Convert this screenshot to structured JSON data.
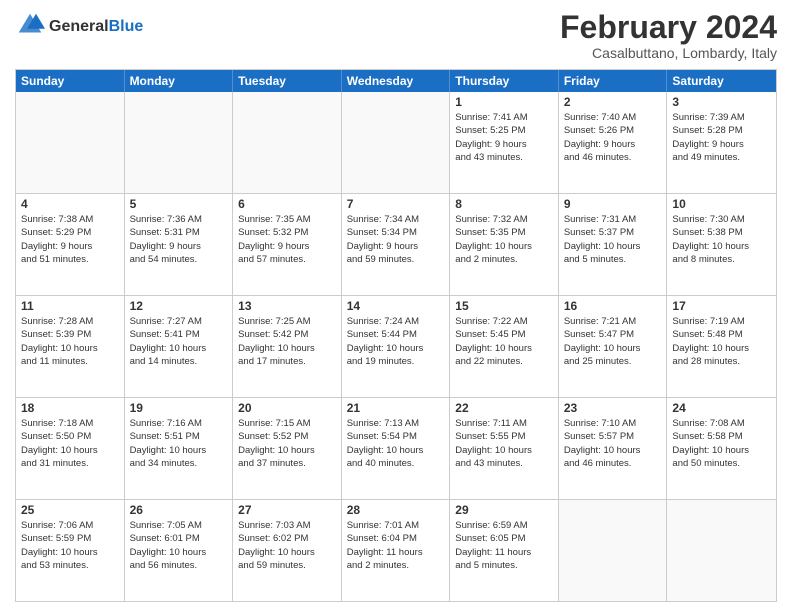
{
  "header": {
    "logo_general": "General",
    "logo_blue": "Blue",
    "main_title": "February 2024",
    "subtitle": "Casalbuttano, Lombardy, Italy"
  },
  "calendar": {
    "days_of_week": [
      "Sunday",
      "Monday",
      "Tuesday",
      "Wednesday",
      "Thursday",
      "Friday",
      "Saturday"
    ],
    "weeks": [
      [
        {
          "day": "",
          "info": ""
        },
        {
          "day": "",
          "info": ""
        },
        {
          "day": "",
          "info": ""
        },
        {
          "day": "",
          "info": ""
        },
        {
          "day": "1",
          "info": "Sunrise: 7:41 AM\nSunset: 5:25 PM\nDaylight: 9 hours\nand 43 minutes."
        },
        {
          "day": "2",
          "info": "Sunrise: 7:40 AM\nSunset: 5:26 PM\nDaylight: 9 hours\nand 46 minutes."
        },
        {
          "day": "3",
          "info": "Sunrise: 7:39 AM\nSunset: 5:28 PM\nDaylight: 9 hours\nand 49 minutes."
        }
      ],
      [
        {
          "day": "4",
          "info": "Sunrise: 7:38 AM\nSunset: 5:29 PM\nDaylight: 9 hours\nand 51 minutes."
        },
        {
          "day": "5",
          "info": "Sunrise: 7:36 AM\nSunset: 5:31 PM\nDaylight: 9 hours\nand 54 minutes."
        },
        {
          "day": "6",
          "info": "Sunrise: 7:35 AM\nSunset: 5:32 PM\nDaylight: 9 hours\nand 57 minutes."
        },
        {
          "day": "7",
          "info": "Sunrise: 7:34 AM\nSunset: 5:34 PM\nDaylight: 9 hours\nand 59 minutes."
        },
        {
          "day": "8",
          "info": "Sunrise: 7:32 AM\nSunset: 5:35 PM\nDaylight: 10 hours\nand 2 minutes."
        },
        {
          "day": "9",
          "info": "Sunrise: 7:31 AM\nSunset: 5:37 PM\nDaylight: 10 hours\nand 5 minutes."
        },
        {
          "day": "10",
          "info": "Sunrise: 7:30 AM\nSunset: 5:38 PM\nDaylight: 10 hours\nand 8 minutes."
        }
      ],
      [
        {
          "day": "11",
          "info": "Sunrise: 7:28 AM\nSunset: 5:39 PM\nDaylight: 10 hours\nand 11 minutes."
        },
        {
          "day": "12",
          "info": "Sunrise: 7:27 AM\nSunset: 5:41 PM\nDaylight: 10 hours\nand 14 minutes."
        },
        {
          "day": "13",
          "info": "Sunrise: 7:25 AM\nSunset: 5:42 PM\nDaylight: 10 hours\nand 17 minutes."
        },
        {
          "day": "14",
          "info": "Sunrise: 7:24 AM\nSunset: 5:44 PM\nDaylight: 10 hours\nand 19 minutes."
        },
        {
          "day": "15",
          "info": "Sunrise: 7:22 AM\nSunset: 5:45 PM\nDaylight: 10 hours\nand 22 minutes."
        },
        {
          "day": "16",
          "info": "Sunrise: 7:21 AM\nSunset: 5:47 PM\nDaylight: 10 hours\nand 25 minutes."
        },
        {
          "day": "17",
          "info": "Sunrise: 7:19 AM\nSunset: 5:48 PM\nDaylight: 10 hours\nand 28 minutes."
        }
      ],
      [
        {
          "day": "18",
          "info": "Sunrise: 7:18 AM\nSunset: 5:50 PM\nDaylight: 10 hours\nand 31 minutes."
        },
        {
          "day": "19",
          "info": "Sunrise: 7:16 AM\nSunset: 5:51 PM\nDaylight: 10 hours\nand 34 minutes."
        },
        {
          "day": "20",
          "info": "Sunrise: 7:15 AM\nSunset: 5:52 PM\nDaylight: 10 hours\nand 37 minutes."
        },
        {
          "day": "21",
          "info": "Sunrise: 7:13 AM\nSunset: 5:54 PM\nDaylight: 10 hours\nand 40 minutes."
        },
        {
          "day": "22",
          "info": "Sunrise: 7:11 AM\nSunset: 5:55 PM\nDaylight: 10 hours\nand 43 minutes."
        },
        {
          "day": "23",
          "info": "Sunrise: 7:10 AM\nSunset: 5:57 PM\nDaylight: 10 hours\nand 46 minutes."
        },
        {
          "day": "24",
          "info": "Sunrise: 7:08 AM\nSunset: 5:58 PM\nDaylight: 10 hours\nand 50 minutes."
        }
      ],
      [
        {
          "day": "25",
          "info": "Sunrise: 7:06 AM\nSunset: 5:59 PM\nDaylight: 10 hours\nand 53 minutes."
        },
        {
          "day": "26",
          "info": "Sunrise: 7:05 AM\nSunset: 6:01 PM\nDaylight: 10 hours\nand 56 minutes."
        },
        {
          "day": "27",
          "info": "Sunrise: 7:03 AM\nSunset: 6:02 PM\nDaylight: 10 hours\nand 59 minutes."
        },
        {
          "day": "28",
          "info": "Sunrise: 7:01 AM\nSunset: 6:04 PM\nDaylight: 11 hours\nand 2 minutes."
        },
        {
          "day": "29",
          "info": "Sunrise: 6:59 AM\nSunset: 6:05 PM\nDaylight: 11 hours\nand 5 minutes."
        },
        {
          "day": "",
          "info": ""
        },
        {
          "day": "",
          "info": ""
        }
      ]
    ]
  }
}
